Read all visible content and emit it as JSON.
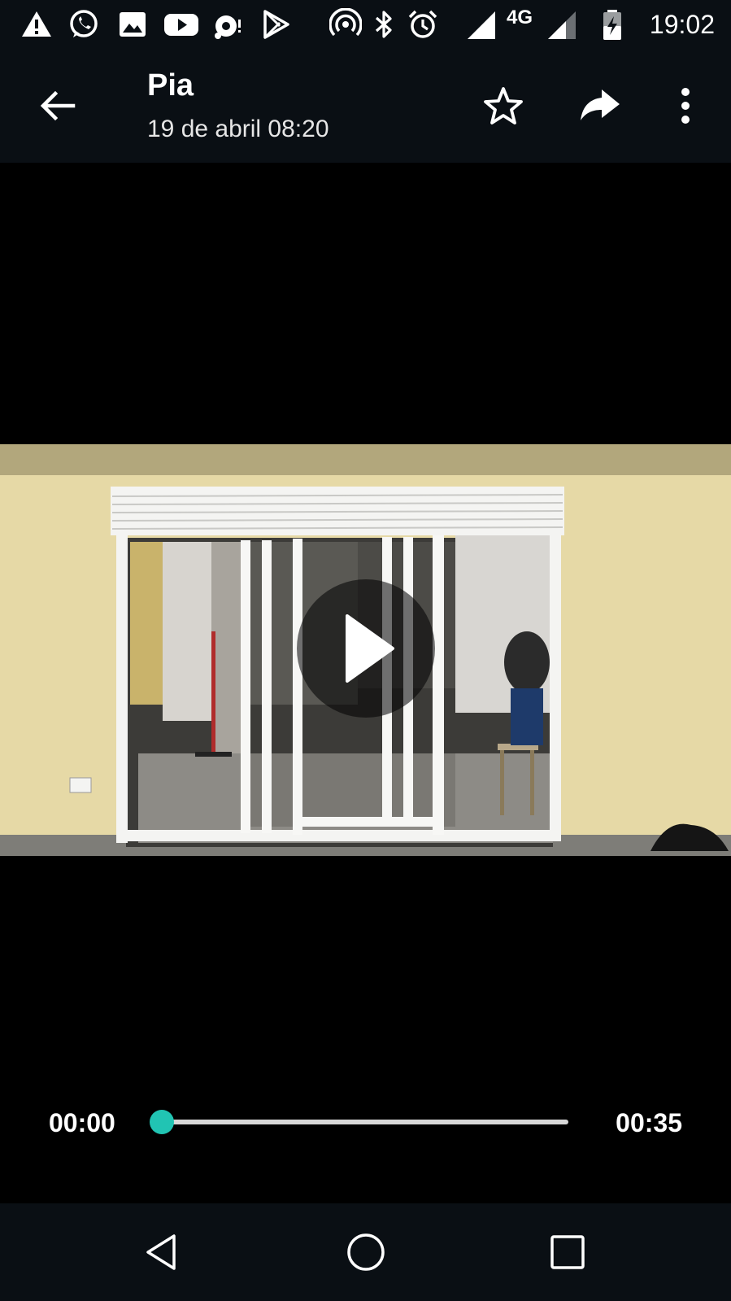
{
  "status_bar": {
    "icons": [
      "warning-icon",
      "whatsapp-icon",
      "gallery-icon",
      "youtube-icon",
      "camera-icon",
      "play-store-icon",
      "hotspot-icon",
      "bluetooth-icon",
      "alarm-icon",
      "signal-icon",
      "signal-icon-2",
      "battery-charging-icon"
    ],
    "network_label": "4G",
    "time": "19:02"
  },
  "app_bar": {
    "title": "Pia",
    "subtitle": "19 de abril 08:20",
    "icons": [
      "back-arrow-icon",
      "star-icon",
      "share-icon",
      "more-vert-icon"
    ]
  },
  "player": {
    "current_time": "00:00",
    "total_time": "00:35",
    "progress": 0.0,
    "accent_color": "#21c4b3"
  },
  "nav_bar": {
    "icons": [
      "nav-back-icon",
      "nav-home-icon",
      "nav-recents-icon"
    ]
  }
}
